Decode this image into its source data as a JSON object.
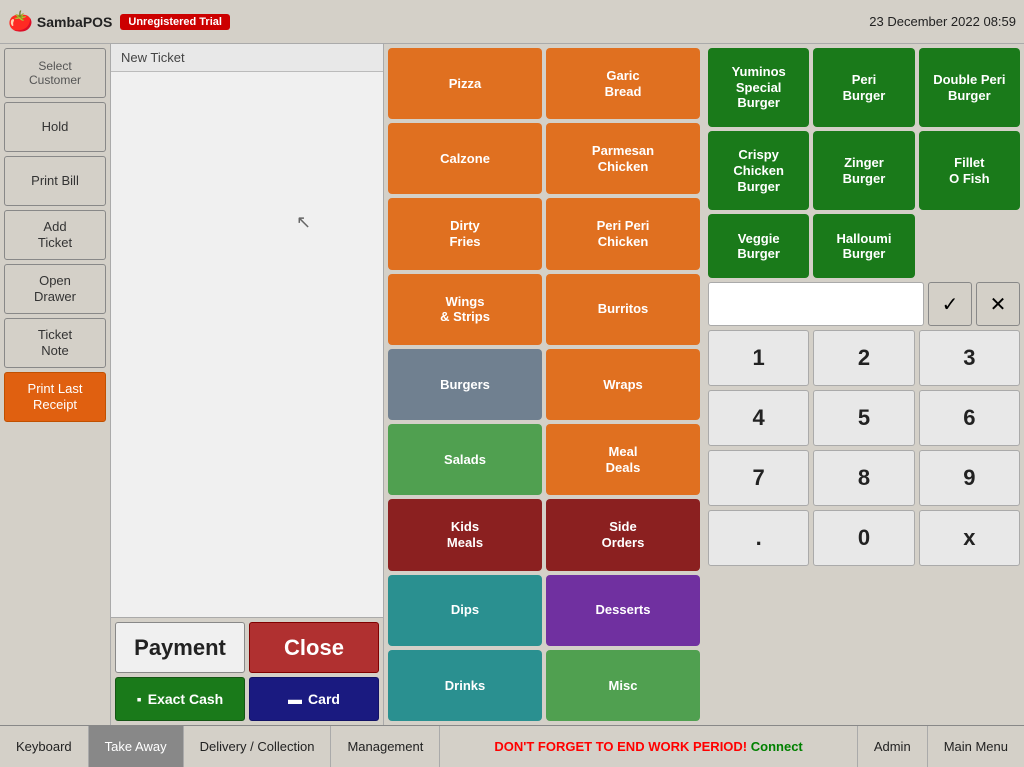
{
  "topbar": {
    "brand": "SambaPOS",
    "badge": "Unregistered Trial",
    "datetime": "23 December 2022  08:59"
  },
  "left_panel": {
    "select_customer": "Select\nCustomer",
    "hold": "Hold",
    "print_bill": "Print Bill",
    "add_ticket": "Add\nTicket",
    "open_drawer": "Open\nDrawer",
    "ticket_note": "Ticket\nNote",
    "print_last_receipt": "Print Last\nReceipt"
  },
  "ticket": {
    "header": "New Ticket"
  },
  "actions": {
    "payment": "Payment",
    "close": "Close",
    "exact_cash": "Exact Cash",
    "card": "Card"
  },
  "menu": {
    "items": [
      {
        "label": "Pizza",
        "color": "orange"
      },
      {
        "label": "Garic\nBread",
        "color": "orange"
      },
      {
        "label": "Calzone",
        "color": "orange"
      },
      {
        "label": "Parmesan\nChicken",
        "color": "orange"
      },
      {
        "label": "Dirty\nFries",
        "color": "orange"
      },
      {
        "label": "Peri Peri\nChicken",
        "color": "orange"
      },
      {
        "label": "Wings\n& Strips",
        "color": "orange"
      },
      {
        "label": "Burritos",
        "color": "orange"
      },
      {
        "label": "Burgers",
        "color": "gray"
      },
      {
        "label": "Wraps",
        "color": "orange"
      },
      {
        "label": "Salads",
        "color": "light-green"
      },
      {
        "label": "Meal\nDeals",
        "color": "orange"
      },
      {
        "label": "Kids\nMeals",
        "color": "dark-red"
      },
      {
        "label": "Side\nOrders",
        "color": "dark-red"
      },
      {
        "label": "Dips",
        "color": "teal"
      },
      {
        "label": "Desserts",
        "color": "purple"
      },
      {
        "label": "Drinks",
        "color": "teal"
      },
      {
        "label": "Misc",
        "color": "light-green"
      }
    ]
  },
  "burgers": {
    "items": [
      {
        "label": "Yuminos\nSpecial Burger"
      },
      {
        "label": "Peri\nBurger"
      },
      {
        "label": "Double Peri\nBurger"
      },
      {
        "label": "Crispy\nChicken Burger"
      },
      {
        "label": "Zinger\nBurger"
      },
      {
        "label": "Fillet\nO Fish"
      },
      {
        "label": "Veggie\nBurger"
      },
      {
        "label": "Halloumi\nBurger"
      }
    ]
  },
  "numpad": {
    "keys": [
      "1",
      "2",
      "3",
      "4",
      "5",
      "6",
      "7",
      "8",
      "9",
      ".",
      "0",
      "x"
    ]
  },
  "bottom_bar": {
    "keyboard": "Keyboard",
    "take_away": "Take Away",
    "delivery_collection": "Delivery / Collection",
    "management": "Management",
    "status_work": "DON'T FORGET TO END WORK PERIOD!",
    "status_connect": "Connect",
    "admin": "Admin",
    "main_menu": "Main Menu"
  }
}
